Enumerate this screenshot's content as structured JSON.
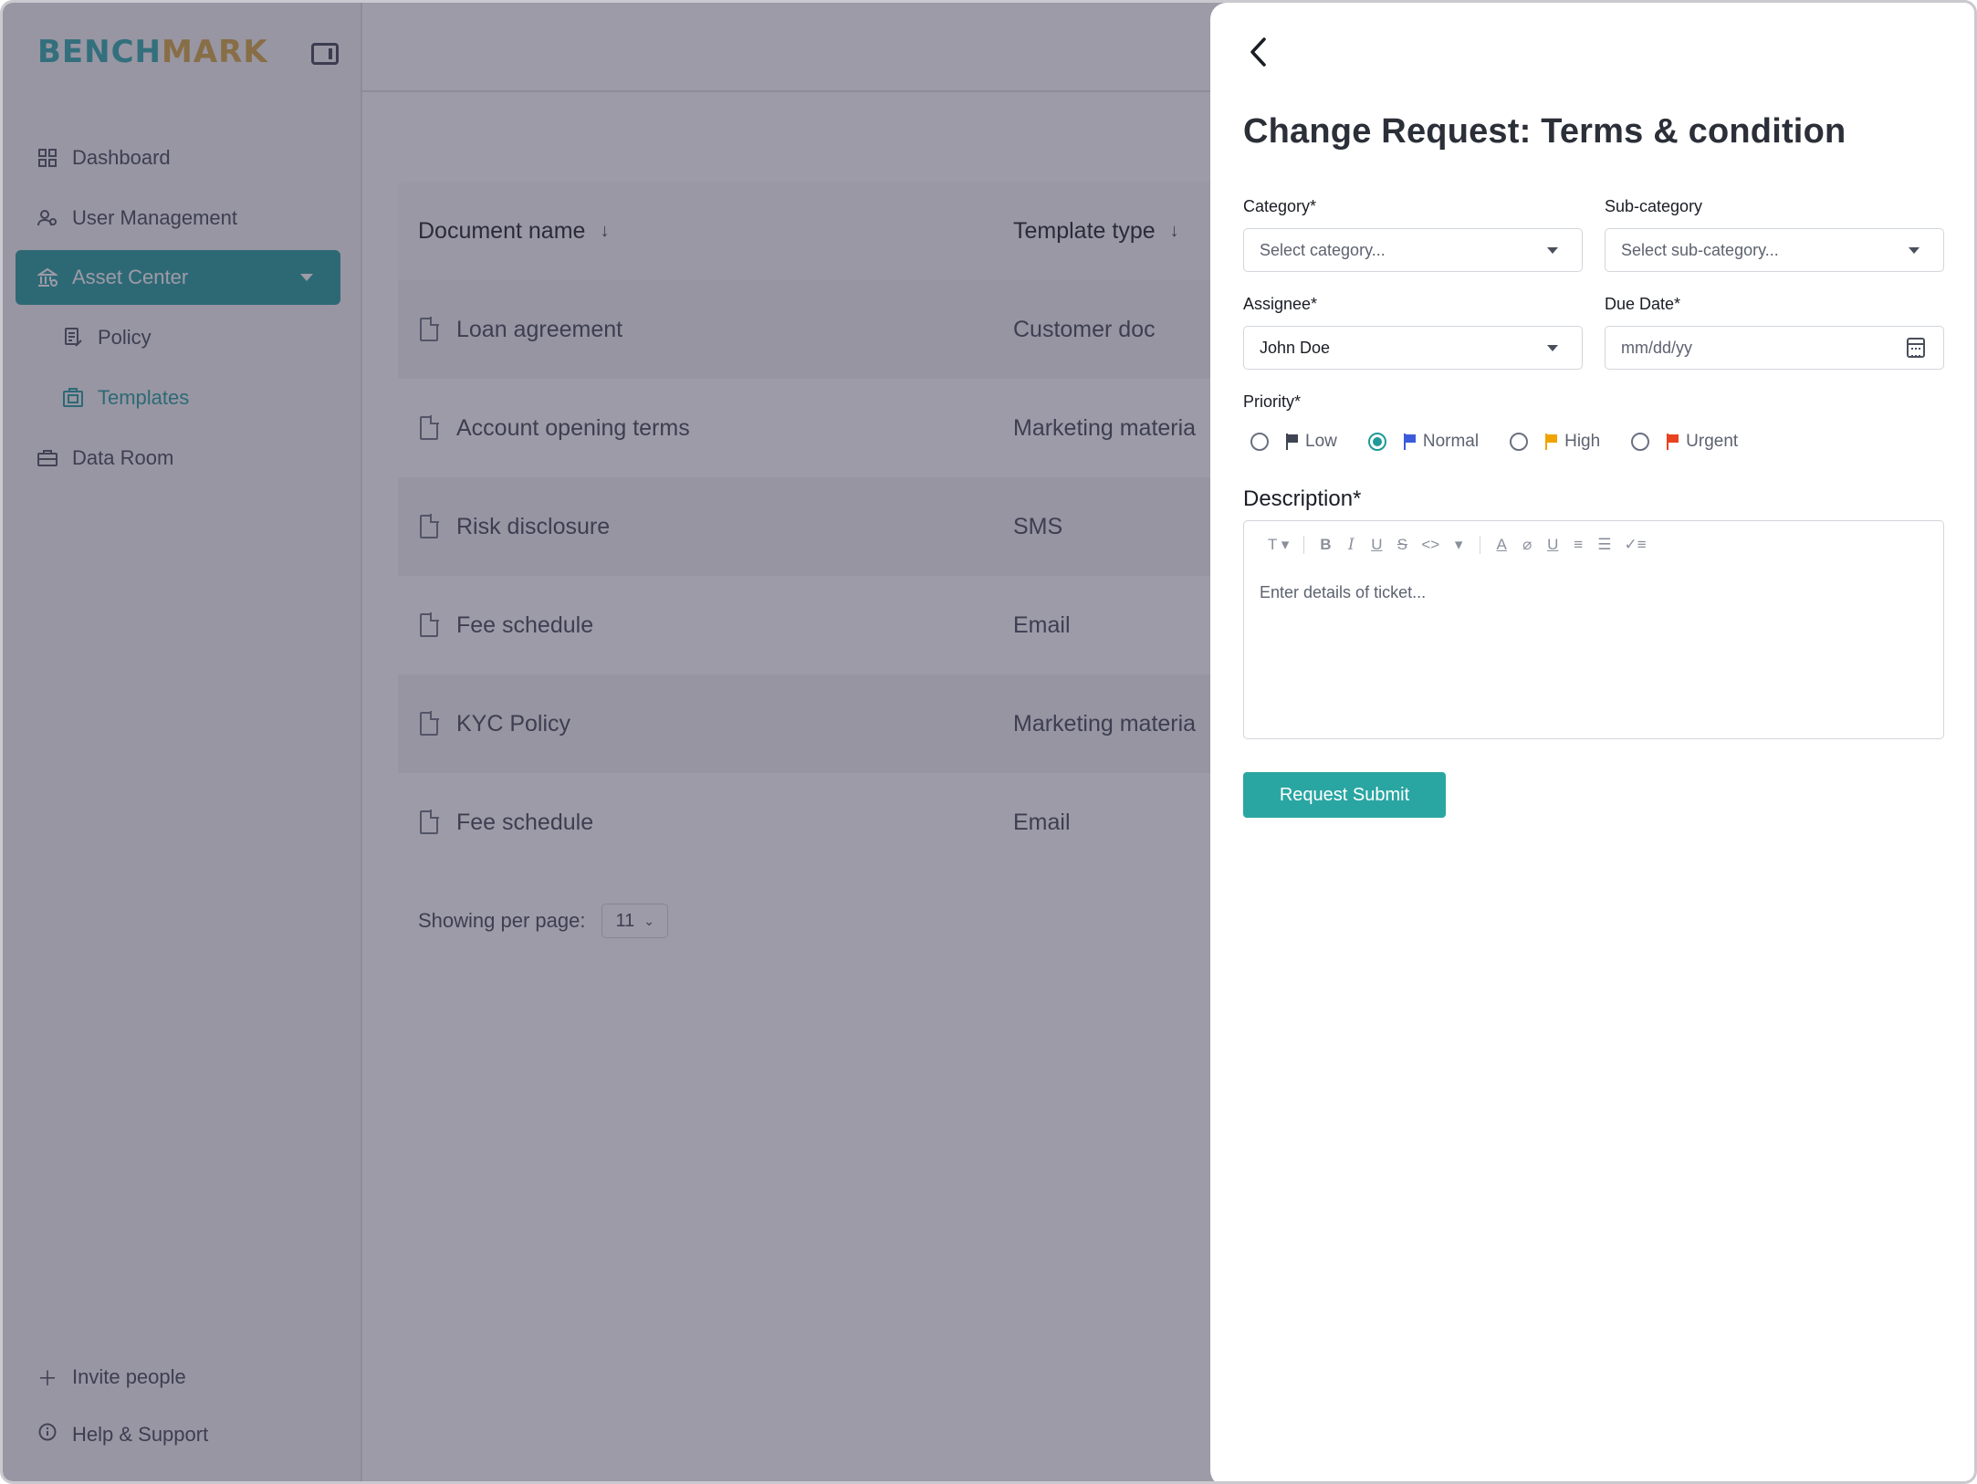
{
  "brand": {
    "logo_left": "BENCH",
    "logo_right": "MARK"
  },
  "sidebar": {
    "items": [
      {
        "label": "Dashboard",
        "icon": "grid-icon"
      },
      {
        "label": "User Management",
        "icon": "users-icon"
      },
      {
        "label": "Asset Center",
        "icon": "bank-icon"
      },
      {
        "label": "Policy",
        "icon": "policy-icon"
      },
      {
        "label": "Templates",
        "icon": "template-icon"
      },
      {
        "label": "Data Room",
        "icon": "briefcase-icon"
      }
    ],
    "invite": "Invite people",
    "help": "Help & Support"
  },
  "table": {
    "columns": [
      "Document name",
      "Template type"
    ],
    "rows": [
      {
        "name": "Loan agreement",
        "type": "Customer doc"
      },
      {
        "name": "Account opening terms",
        "type": "Marketing materia"
      },
      {
        "name": "Risk disclosure",
        "type": "SMS"
      },
      {
        "name": "Fee schedule",
        "type": "Email"
      },
      {
        "name": "KYC Policy",
        "type": "Marketing materia"
      },
      {
        "name": "Fee schedule",
        "type": "Email"
      }
    ],
    "pager_label": "Showing per page:",
    "pager_value": "11"
  },
  "panel": {
    "title": "Change Request: Terms & condition",
    "category_label": "Category*",
    "category_placeholder": "Select category...",
    "subcategory_label": "Sub-category",
    "subcategory_placeholder": "Select sub-category...",
    "assignee_label": "Assignee*",
    "assignee_value": "John Doe",
    "due_label": "Due Date*",
    "due_placeholder": "mm/dd/yy",
    "priority_label": "Priority*",
    "priorities": [
      {
        "label": "Low",
        "color": "#3e4452",
        "selected": false
      },
      {
        "label": "Normal",
        "color": "#3b5bdb",
        "selected": true
      },
      {
        "label": "High",
        "color": "#f0a400",
        "selected": false
      },
      {
        "label": "Urgent",
        "color": "#e8421f",
        "selected": false
      }
    ],
    "description_label": "Description*",
    "description_placeholder": "Enter details of ticket...",
    "submit_label": "Request Submit"
  },
  "colors": {
    "accent": "#1f9a9a",
    "button": "#2aa6a2",
    "logo_teal": "#2aa6a8",
    "logo_gold": "#d4a43c"
  }
}
